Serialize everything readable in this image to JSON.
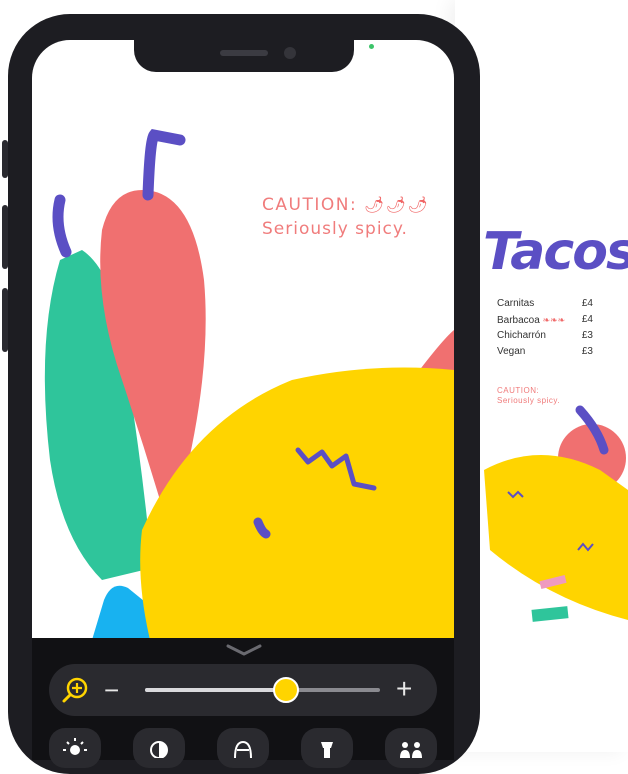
{
  "screen": {
    "caution_label": "CAUTION:",
    "caution_chilis": "🌶🌶🌶",
    "caution_sub": "Seriously spicy."
  },
  "menu_card": {
    "logo": "Tacos",
    "items": [
      {
        "name": "Carnitas",
        "spice": "",
        "price": "£4"
      },
      {
        "name": "Barbacoa",
        "spice": "❧❧❧",
        "price": "£4"
      },
      {
        "name": "Chicharrón",
        "spice": "",
        "price": "£3"
      },
      {
        "name": "Vegan",
        "spice": "",
        "price": "£3"
      }
    ],
    "caution_label": "CAUTION:",
    "caution_sub": "Seriously spicy."
  },
  "controls": {
    "minus_label": "−",
    "plus_label": "+",
    "zoom_level": 0.6,
    "tools": [
      {
        "icon": "brightness-icon"
      },
      {
        "icon": "contrast-icon"
      },
      {
        "icon": "filter-icon"
      },
      {
        "icon": "flashlight-icon"
      },
      {
        "icon": "people-icon"
      }
    ]
  },
  "colors": {
    "accent": "#ffd400",
    "brand": "#5b4fc4",
    "caution": "#f07c7c"
  }
}
